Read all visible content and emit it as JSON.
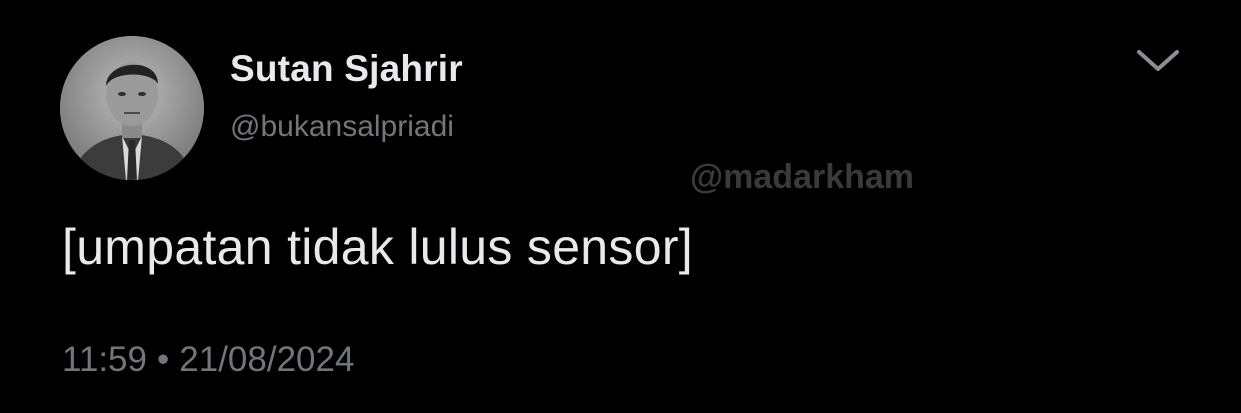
{
  "author": {
    "display_name": "Sutan Sjahrir",
    "handle": "@bukansalpriadi",
    "avatar_icon": "portrait-photo"
  },
  "watermark": "@madarkham",
  "more_icon": "chevron-down-icon",
  "tweet": {
    "text": "[umpatan tidak lulus sensor]",
    "time": "11:59",
    "separator": "•",
    "date": "21/08/2024"
  },
  "colors": {
    "background": "#000000",
    "primary_text": "#e7e9ea",
    "secondary_text": "#71767b"
  }
}
